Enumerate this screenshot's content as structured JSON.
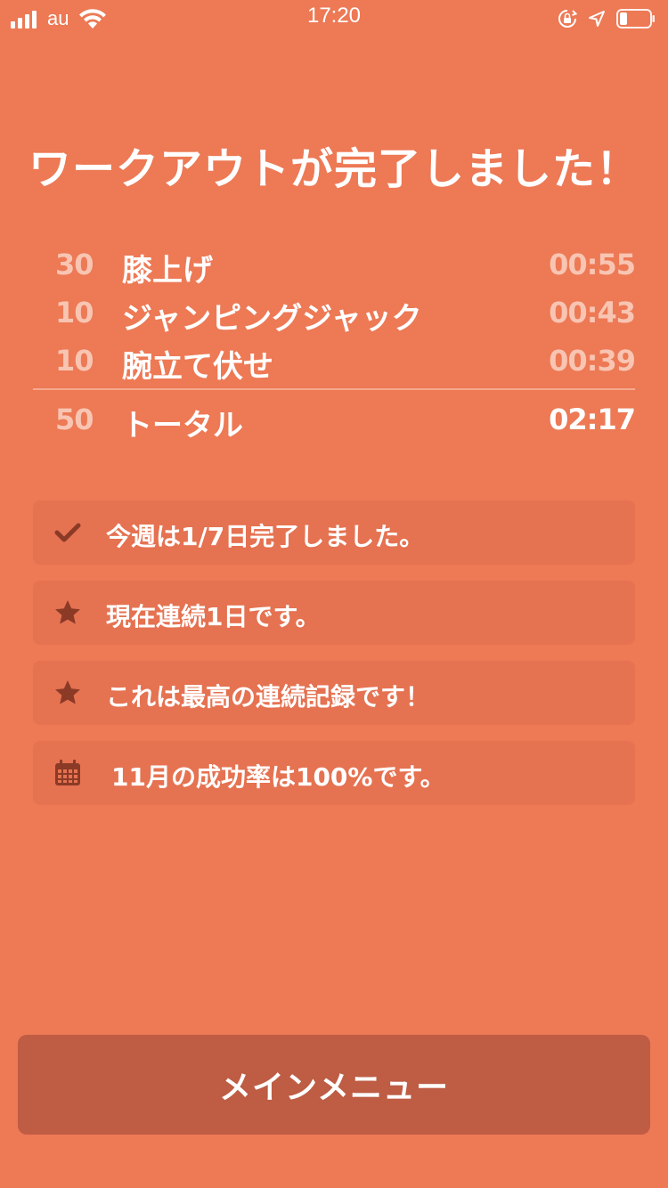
{
  "status_bar": {
    "carrier": "au",
    "time": "17:20",
    "signal_bars": 4,
    "icons": [
      "signal-icon",
      "wifi-icon",
      "orientation-lock-icon",
      "location-arrow-icon",
      "battery-icon"
    ]
  },
  "title": "ワークアウトが完了しました！",
  "summary": {
    "rows": [
      {
        "count": "30",
        "name": "膝上げ",
        "time": "00:55"
      },
      {
        "count": "10",
        "name": "ジャンピングジャック",
        "time": "00:43"
      },
      {
        "count": "10",
        "name": "腕立て伏せ",
        "time": "00:39"
      }
    ],
    "total": {
      "count": "50",
      "name": "トータル",
      "time": "02:17"
    }
  },
  "cards": [
    {
      "icon": "checkmark-icon",
      "text": "今週は1/7日完了しました。"
    },
    {
      "icon": "star-icon",
      "text": "現在連続1日です。"
    },
    {
      "icon": "star-icon",
      "text": "これは最高の連続記録です！"
    },
    {
      "icon": "calendar-icon",
      "text": "11月の成功率は100%です。"
    }
  ],
  "main_button": {
    "label": "メインメニュー"
  },
  "colors": {
    "background": "#ED7955",
    "card": "#E57251",
    "button": "#BE5C44",
    "icon": "#8B3A26",
    "muted_text": "#F9C5B3",
    "text": "#FFFFFF"
  }
}
